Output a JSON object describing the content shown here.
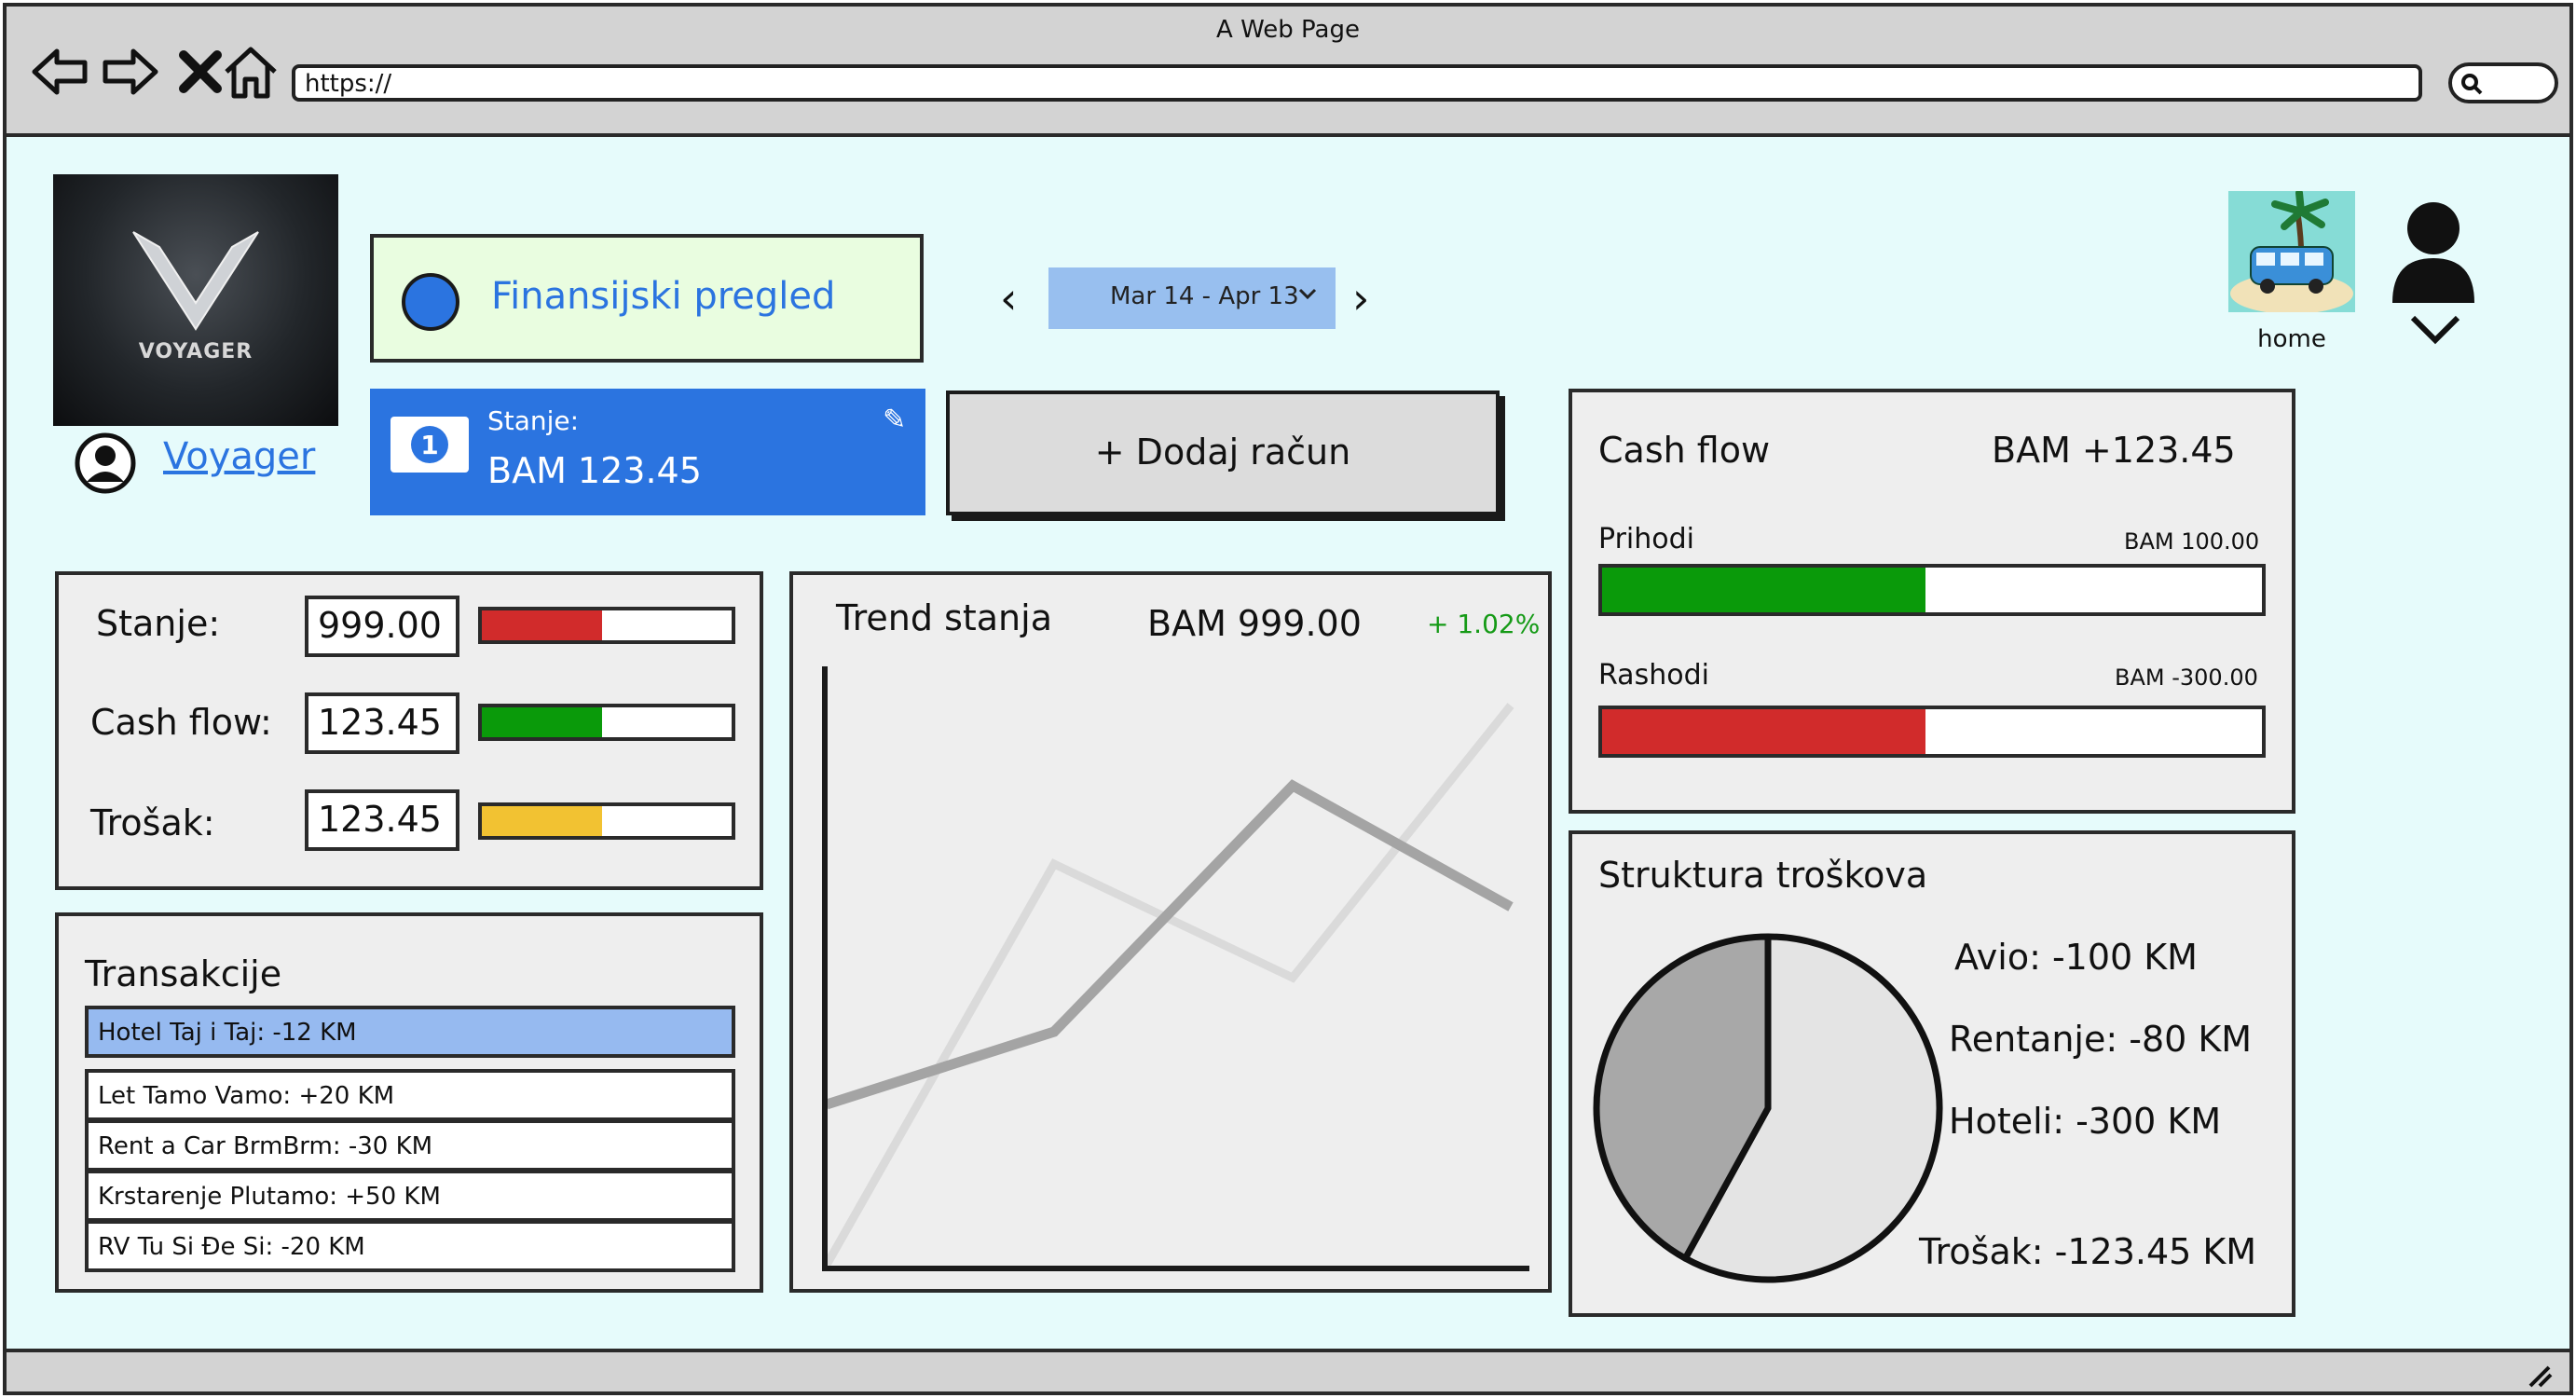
{
  "browser": {
    "title": "A Web Page",
    "url": "https://"
  },
  "brand": {
    "logo_text": "VOYAGER",
    "username": "Voyager"
  },
  "header": {
    "overview_label": "Finansijski pregled",
    "date_range": "Mar 14 - Apr 13",
    "home_label": "home"
  },
  "balance_card": {
    "label": "Stanje:",
    "value": "BAM 123.45"
  },
  "add_button": {
    "label": "+ Dodaj račun"
  },
  "stats": [
    {
      "label": "Stanje:",
      "value": "999.00",
      "level": 0.48,
      "color": "#d12b2b"
    },
    {
      "label": "Cash flow:",
      "value": "123.45",
      "level": 0.48,
      "color": "#0a9a0a"
    },
    {
      "label": "Trošak:",
      "value": "123.45",
      "level": 0.48,
      "color": "#f2c232"
    }
  ],
  "transactions": {
    "title": "Transakcije",
    "items": [
      "Hotel Taj i Taj: -12 KM",
      "Let Tamo Vamo: +20 KM",
      "Rent a Car BrmBrm: -30 KM",
      "Krstarenje Plutamo: +50 KM",
      "RV Tu Si Đe Si: -20 KM"
    ],
    "selected_color": "#96baf0"
  },
  "trend": {
    "title": "Trend stanja",
    "value": "BAM 999.00",
    "change": "+ 1.02%",
    "change_color": "#159a16"
  },
  "cashflow": {
    "title": "Cash flow",
    "total": "BAM +123.45",
    "income_label": "Prihodi",
    "income_amount": "BAM 100.00",
    "income_level": 0.49,
    "income_color": "#0a9a0a",
    "expense_label": "Rashodi",
    "expense_amount": "BAM -300.00",
    "expense_level": 0.49,
    "expense_color": "#d12b2b"
  },
  "costs": {
    "title": "Struktura troškova",
    "items": [
      "Avio: -100 KM",
      "Rentanje: -80 KM",
      "Hoteli: -300 KM"
    ],
    "total": "Trošak: -123.45 KM",
    "pie_slices": [
      0.58,
      0.42
    ],
    "pie_colors": [
      "#e4e4e4",
      "#a8a8a8"
    ]
  },
  "colors": {
    "accent": "#2b74e0",
    "page_bg": "#e6fbfb",
    "panel_bg": "#eeeeee"
  }
}
